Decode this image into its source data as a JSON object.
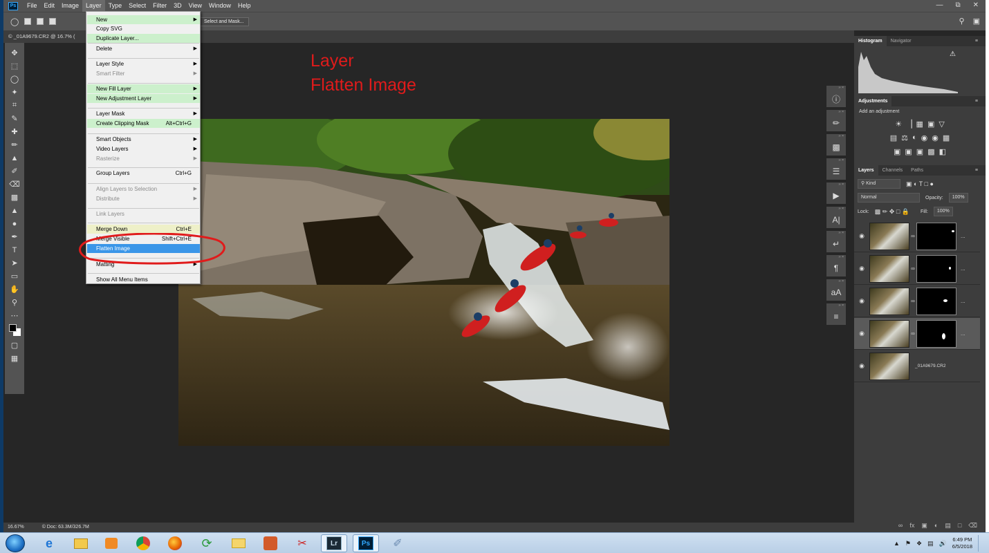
{
  "app": {
    "logo": "Ps",
    "menu": [
      "File",
      "Edit",
      "Image",
      "Layer",
      "Type",
      "Select",
      "Filter",
      "3D",
      "View",
      "Window",
      "Help"
    ],
    "active_menu": "Layer"
  },
  "options_bar": {
    "select_and_mask": "Select and Mask..."
  },
  "document": {
    "tab_title": "© _01A9679.CR2 @ 16.7% (",
    "zoom": "16.67%",
    "doc_size": "© Doc: 63.3M/326.7M"
  },
  "annotation": {
    "line1": "Layer",
    "line2": "Flatten Image",
    "color": "#e01b1b"
  },
  "layer_menu": {
    "items": [
      {
        "label": "New",
        "arrow": true,
        "state": "highlight"
      },
      {
        "label": "Copy SVG",
        "state": "normal"
      },
      {
        "label": "Duplicate Layer...",
        "state": "highlight"
      },
      {
        "label": "Delete",
        "arrow": true,
        "state": "normal"
      },
      {
        "label": "Layer Style",
        "arrow": true,
        "state": "normal"
      },
      {
        "label": "Smart Filter",
        "arrow": true,
        "state": "disabled"
      },
      {
        "label": "New Fill Layer",
        "arrow": true,
        "state": "highlight"
      },
      {
        "label": "New Adjustment Layer",
        "arrow": true,
        "state": "highlight"
      },
      {
        "label": "Layer Mask",
        "arrow": true,
        "state": "normal"
      },
      {
        "label": "Create Clipping Mask",
        "shortcut": "Alt+Ctrl+G",
        "state": "highlight"
      },
      {
        "label": "Smart Objects",
        "arrow": true,
        "state": "normal"
      },
      {
        "label": "Video Layers",
        "arrow": true,
        "state": "normal"
      },
      {
        "label": "Rasterize",
        "arrow": true,
        "state": "disabled"
      },
      {
        "label": "Group Layers",
        "shortcut": "Ctrl+G",
        "state": "normal"
      },
      {
        "label": "Align Layers to Selection",
        "arrow": true,
        "state": "disabled"
      },
      {
        "label": "Distribute",
        "arrow": true,
        "state": "disabled"
      },
      {
        "label": "Link Layers",
        "state": "disabled"
      },
      {
        "label": "Merge Down",
        "shortcut": "Ctrl+E",
        "state": "yellow"
      },
      {
        "label": "Merge Visible",
        "shortcut": "Shift+Ctrl+E",
        "state": "normal"
      },
      {
        "label": "Flatten Image",
        "state": "selected"
      },
      {
        "label": "Matting",
        "arrow": true,
        "state": "normal"
      },
      {
        "label": "Show All Menu Items",
        "state": "normal"
      }
    ]
  },
  "panels": {
    "top_tabs": [
      "Histogram",
      "Navigator"
    ],
    "adjustments": {
      "tab": "Adjustments",
      "subtitle": "Add an adjustment"
    },
    "layers_tabs": [
      "Layers",
      "Channels",
      "Paths"
    ],
    "kind": "Kind",
    "blend_mode": "Normal",
    "opacity_label": "Opacity:",
    "opacity": "100%",
    "lock_label": "Lock:",
    "fill_label": "Fill:",
    "fill": "100%",
    "layers": [
      {
        "name": "...",
        "has_mask": true
      },
      {
        "name": "...",
        "has_mask": true
      },
      {
        "name": "...",
        "has_mask": true
      },
      {
        "name": "...",
        "has_mask": true,
        "selected": true
      },
      {
        "name": "_01A9679.CR2",
        "has_mask": false
      }
    ]
  },
  "taskbar": {
    "time": "6:49 PM",
    "date": "6/5/2018",
    "apps": [
      "Lr",
      "Ps"
    ]
  }
}
